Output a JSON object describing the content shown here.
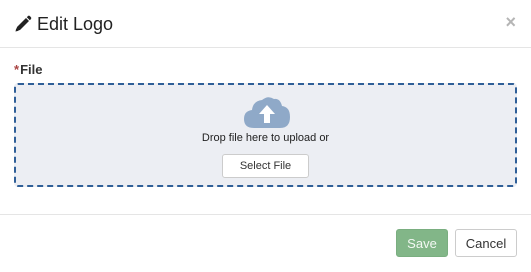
{
  "dialog": {
    "title": "Edit Logo",
    "title_icon": "pencil-icon",
    "close_label": "×"
  },
  "form": {
    "file_field": {
      "required_marker": "*",
      "label": "File",
      "dropzone_icon": "cloud-upload-icon",
      "drop_text": "Drop file here to upload or",
      "select_button_label": "Select File"
    }
  },
  "footer": {
    "save_label": "Save",
    "cancel_label": "Cancel"
  },
  "colors": {
    "dropzone_border": "#2f5f98",
    "dropzone_background": "#eceef3",
    "cloud_icon": "#8fa9c8",
    "save_button": "#82b688",
    "required_star": "#a94442"
  }
}
